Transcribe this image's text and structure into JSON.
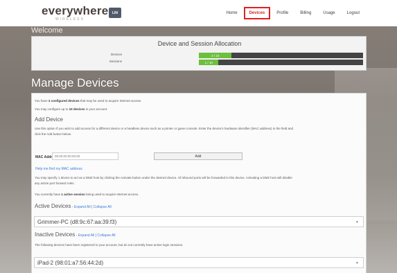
{
  "header": {
    "logo": "everywhere",
    "logo_sub": "WIRELESS",
    "badge": "LIN",
    "nav": [
      {
        "label": "Home"
      },
      {
        "label": "Devices",
        "active": true
      },
      {
        "label": "Profile"
      },
      {
        "label": "Billing"
      },
      {
        "label": "Usage"
      },
      {
        "label": "Logout"
      }
    ],
    "active_color": "#e02020"
  },
  "welcome": "Welcome",
  "allocation": {
    "title": "Device and Session Allocation",
    "rows": [
      {
        "label": "Devices",
        "value": "2 / 10",
        "fraction": 0.2
      },
      {
        "label": "Sessions",
        "value": "1 / 10",
        "fraction": 0.12
      }
    ],
    "fill_color": "#6dbf3e"
  },
  "manage": {
    "title": "Manage Devices",
    "intro1_pre": "You have ",
    "intro1_bold": "2 configured devices",
    "intro1_post": " that may be used to acquire Internet access.",
    "intro2_pre": "You may configure up to ",
    "intro2_bold": "10 devices",
    "intro2_post": " in your account.",
    "add_device": {
      "heading": "Add Device",
      "desc1": "Use this option if you wish to add access for a different device or a headless device such as a printer or game console. Enter the device's hardware identifier (MAC address) in the field and",
      "desc2": "click the Add button below.",
      "mac_label": "MAC Address:",
      "mac_placeholder": "00:00:00:00:00:00",
      "add_button": "Add",
      "help_link": "Help me find my MAC address",
      "dmz1": "You may specify 1 device to act as a DMZ host by clicking the Activate button under the desired device. All inbound ports will be forwarded to this device. Activating a DMZ host will disable",
      "dmz2": "any active port forward rules.",
      "session_pre": "You currently have ",
      "session_bold": "1 active session",
      "session_post": " being used to acquire Internet access."
    },
    "active": {
      "heading": "Active Devices",
      "expand": "Expand All",
      "collapse": "Collapse All",
      "devices": [
        "Grimmer-PC (d8:9c:67:aa:39:f3)"
      ]
    },
    "inactive": {
      "heading": "Inactive Devices",
      "expand": "Expand All",
      "collapse": "Collapse All",
      "desc": "The following devices have been registered to your account, but do not currently have active login sessions.",
      "devices": [
        "iPad-2 (98:01:a7:56:44:2d)"
      ]
    }
  }
}
